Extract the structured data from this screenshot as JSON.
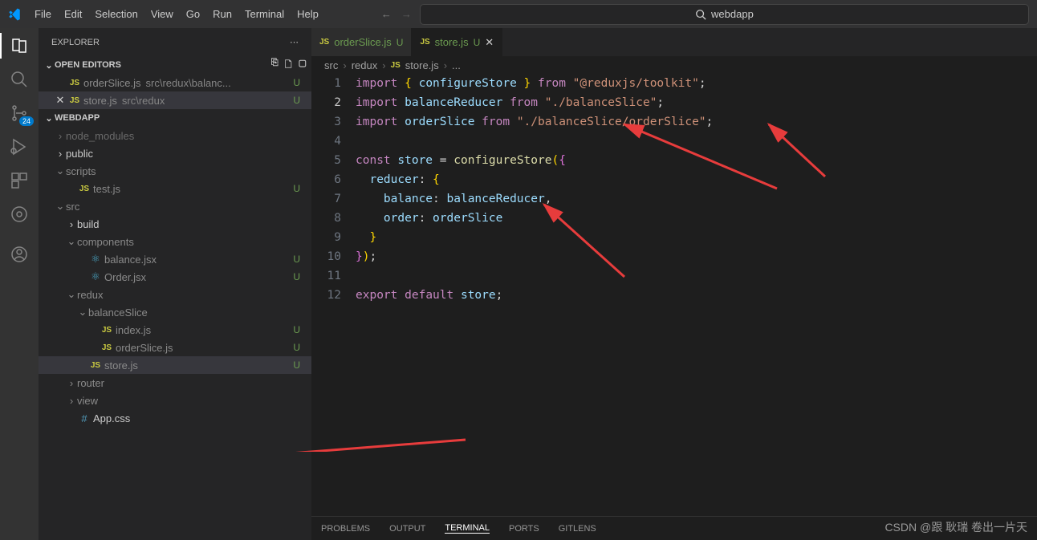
{
  "menu": [
    "File",
    "Edit",
    "Selection",
    "View",
    "Go",
    "Run",
    "Terminal",
    "Help"
  ],
  "search": {
    "text": "webdapp"
  },
  "activity_badge": "24",
  "explorer": {
    "title": "EXPLORER"
  },
  "open_editors": {
    "label": "OPEN EDITORS",
    "items": [
      {
        "name": "orderSlice.js",
        "path": "src\\redux\\balanc...",
        "stat": "U"
      },
      {
        "name": "store.js",
        "path": "src\\redux",
        "stat": "U"
      }
    ]
  },
  "workspace": {
    "label": "WEBDAPP",
    "tree": [
      {
        "indent": 1,
        "chev": "›",
        "name": "node_modules",
        "type": "folder",
        "dim": true
      },
      {
        "indent": 1,
        "chev": "›",
        "name": "public",
        "type": "folder"
      },
      {
        "indent": 1,
        "chev": "⌄",
        "name": "scripts",
        "type": "folder",
        "stat": "dot"
      },
      {
        "indent": 2,
        "icon": "js",
        "name": "test.js",
        "stat": "U"
      },
      {
        "indent": 1,
        "chev": "⌄",
        "name": "src",
        "type": "folder",
        "stat": "dot"
      },
      {
        "indent": 2,
        "chev": "›",
        "name": "build",
        "type": "folder"
      },
      {
        "indent": 2,
        "chev": "⌄",
        "name": "components",
        "type": "folder",
        "stat": "dot"
      },
      {
        "indent": 3,
        "icon": "react",
        "name": "balance.jsx",
        "stat": "U"
      },
      {
        "indent": 3,
        "icon": "react",
        "name": "Order.jsx",
        "stat": "U"
      },
      {
        "indent": 2,
        "chev": "⌄",
        "name": "redux",
        "type": "folder",
        "stat": "dot"
      },
      {
        "indent": 3,
        "chev": "⌄",
        "name": "balanceSlice",
        "type": "folder",
        "stat": "dot"
      },
      {
        "indent": 4,
        "icon": "js",
        "name": "index.js",
        "stat": "U"
      },
      {
        "indent": 4,
        "icon": "js",
        "name": "orderSlice.js",
        "stat": "U"
      },
      {
        "indent": 3,
        "icon": "js",
        "name": "store.js",
        "stat": "U",
        "selected": true
      },
      {
        "indent": 2,
        "chev": "›",
        "name": "router",
        "type": "folder",
        "stat": "dot"
      },
      {
        "indent": 2,
        "chev": "›",
        "name": "view",
        "type": "folder",
        "stat": "dot"
      },
      {
        "indent": 2,
        "icon": "hash",
        "name": "App.css"
      }
    ]
  },
  "tabs": [
    {
      "name": "orderSlice.js",
      "mod": "U",
      "active": false
    },
    {
      "name": "store.js",
      "mod": "U",
      "active": true,
      "close": true
    }
  ],
  "breadcrumb": [
    "src",
    "redux",
    "store.js",
    "..."
  ],
  "code_lines": 12,
  "panel": {
    "tabs": [
      "PROBLEMS",
      "OUTPUT",
      "TERMINAL",
      "PORTS",
      "GITLENS"
    ],
    "active": 2
  },
  "watermark": "CSDN @跟 耿瑞 卷出一片天"
}
